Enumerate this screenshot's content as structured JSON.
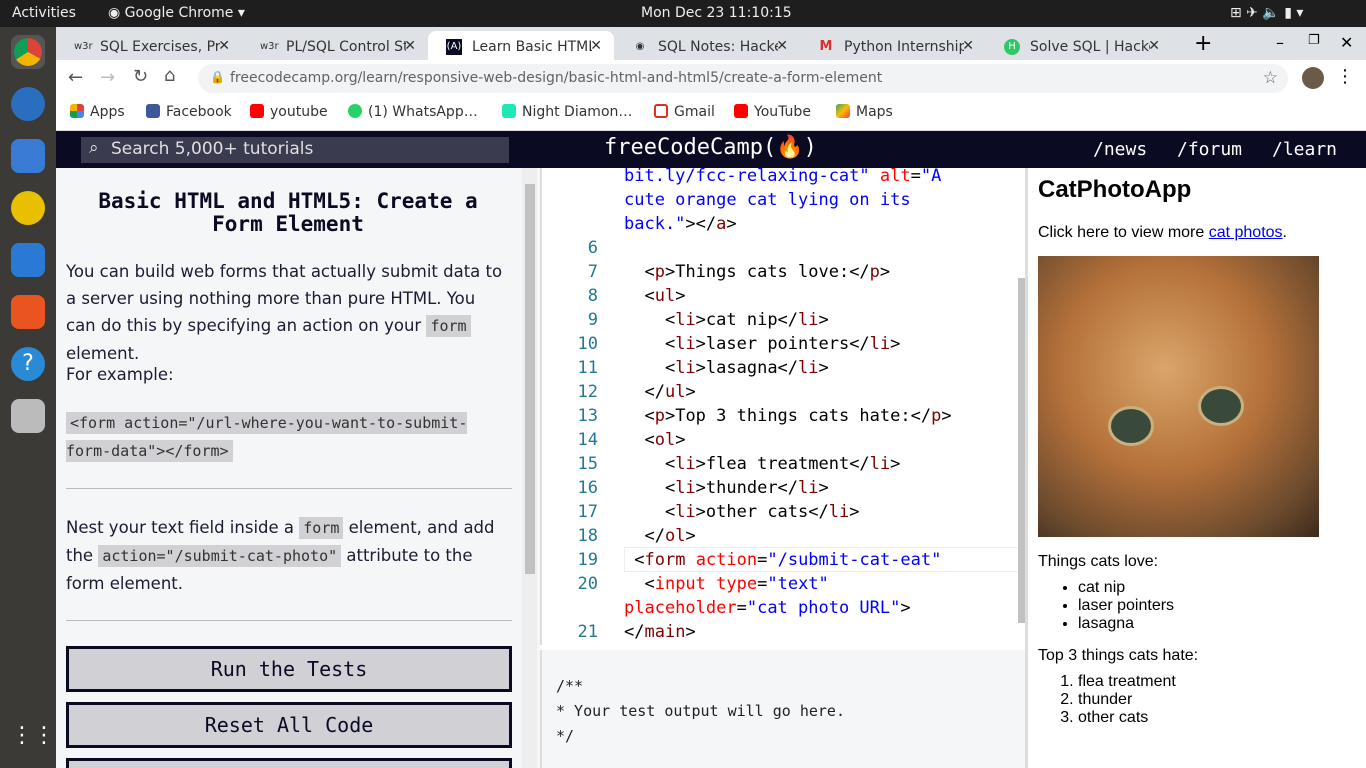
{
  "system": {
    "activities": "Activities",
    "app": "Google Chrome",
    "clock": "Mon Dec 23  11:10:15"
  },
  "tabs": [
    {
      "label": "SQL Exercises, Pra",
      "fav": "w3r"
    },
    {
      "label": "PL/SQL Control St",
      "fav": "w3r"
    },
    {
      "label": "Learn Basic HTML",
      "fav": "(A)",
      "active": true
    },
    {
      "label": "SQL Notes: Hacke",
      "fav": "◉"
    },
    {
      "label": "Python Internship",
      "fav": "M"
    },
    {
      "label": "Solve SQL | Hacker",
      "fav": "H"
    }
  ],
  "address": {
    "url": "freecodecamp.org/learn/responsive-web-design/basic-html-and-html5/create-a-form-element"
  },
  "bookmarks": [
    "Apps",
    "Facebook",
    "youtube",
    "(1) WhatsApp…",
    "Night Diamon…",
    "Gmail",
    "YouTube",
    "Maps"
  ],
  "fcc": {
    "search_placeholder": "Search 5,000+ tutorials",
    "logo": "freeCodeCamp(🔥)",
    "links": [
      "/news",
      "/forum",
      "/learn"
    ]
  },
  "lesson": {
    "title": "Basic HTML and HTML5: Create a Form Element",
    "p1a": "You can build web forms that actually submit data to a server using nothing more than pure HTML. You can do this by specifying an action on your ",
    "p1code": "form",
    "p1b": " element.",
    "p2": "For example:",
    "example": "<form action=\"/url-where-you-want-to-submit-form-data\"></form>",
    "p3a": "Nest your text field inside a ",
    "p3code1": "form",
    "p3b": " element, and add the ",
    "p3code2": "action=\"/submit-cat-photo\"",
    "p3c": " attribute to the form element.",
    "run": "Run the Tests",
    "reset": "Reset All Code"
  },
  "editor": {
    "lines": [
      {
        "n": "",
        "seg": [
          [
            "st",
            "bit.ly/fcc-relaxing-cat\" "
          ],
          [
            "at",
            "alt"
          ],
          [
            "tx",
            "="
          ],
          [
            "st",
            "\"A"
          ]
        ]
      },
      {
        "n": "",
        "seg": [
          [
            "st",
            "cute orange cat lying on its"
          ]
        ]
      },
      {
        "n": "",
        "seg": [
          [
            "st",
            "back.\""
          ],
          [
            "tx",
            "></"
          ],
          [
            "tg",
            "a"
          ],
          [
            "tx",
            ">"
          ]
        ]
      },
      {
        "n": "6",
        "seg": []
      },
      {
        "n": "7",
        "seg": [
          [
            "tx",
            "  <"
          ],
          [
            "tg",
            "p"
          ],
          [
            "tx",
            ">Things cats love:</"
          ],
          [
            "tg",
            "p"
          ],
          [
            "tx",
            ">"
          ]
        ]
      },
      {
        "n": "8",
        "seg": [
          [
            "tx",
            "  <"
          ],
          [
            "tg",
            "ul"
          ],
          [
            "tx",
            ">"
          ]
        ]
      },
      {
        "n": "9",
        "seg": [
          [
            "tx",
            "    <"
          ],
          [
            "tg",
            "li"
          ],
          [
            "tx",
            ">cat nip</"
          ],
          [
            "tg",
            "li"
          ],
          [
            "tx",
            ">"
          ]
        ]
      },
      {
        "n": "10",
        "seg": [
          [
            "tx",
            "    <"
          ],
          [
            "tg",
            "li"
          ],
          [
            "tx",
            ">laser pointers</"
          ],
          [
            "tg",
            "li"
          ],
          [
            "tx",
            ">"
          ]
        ]
      },
      {
        "n": "11",
        "seg": [
          [
            "tx",
            "    <"
          ],
          [
            "tg",
            "li"
          ],
          [
            "tx",
            ">lasagna</"
          ],
          [
            "tg",
            "li"
          ],
          [
            "tx",
            ">"
          ]
        ]
      },
      {
        "n": "12",
        "seg": [
          [
            "tx",
            "  </"
          ],
          [
            "tg",
            "ul"
          ],
          [
            "tx",
            ">"
          ]
        ]
      },
      {
        "n": "13",
        "seg": [
          [
            "tx",
            "  <"
          ],
          [
            "tg",
            "p"
          ],
          [
            "tx",
            ">Top 3 things cats hate:</"
          ],
          [
            "tg",
            "p"
          ],
          [
            "tx",
            ">"
          ]
        ]
      },
      {
        "n": "14",
        "seg": [
          [
            "tx",
            "  <"
          ],
          [
            "tg",
            "ol"
          ],
          [
            "tx",
            ">"
          ]
        ]
      },
      {
        "n": "15",
        "seg": [
          [
            "tx",
            "    <"
          ],
          [
            "tg",
            "li"
          ],
          [
            "tx",
            ">flea treatment</"
          ],
          [
            "tg",
            "li"
          ],
          [
            "tx",
            ">"
          ]
        ]
      },
      {
        "n": "16",
        "seg": [
          [
            "tx",
            "    <"
          ],
          [
            "tg",
            "li"
          ],
          [
            "tx",
            ">thunder</"
          ],
          [
            "tg",
            "li"
          ],
          [
            "tx",
            ">"
          ]
        ]
      },
      {
        "n": "17",
        "seg": [
          [
            "tx",
            "    <"
          ],
          [
            "tg",
            "li"
          ],
          [
            "tx",
            ">other cats</"
          ],
          [
            "tg",
            "li"
          ],
          [
            "tx",
            ">"
          ]
        ]
      },
      {
        "n": "18",
        "seg": [
          [
            "tx",
            "  </"
          ],
          [
            "tg",
            "ol"
          ],
          [
            "tx",
            ">"
          ]
        ]
      },
      {
        "n": "19",
        "seg": [
          [
            "tx",
            " <"
          ],
          [
            "tg",
            "form"
          ],
          [
            "tx",
            " "
          ],
          [
            "at",
            "action"
          ],
          [
            "tx",
            "="
          ],
          [
            "st",
            "\"/submit-cat-eat\""
          ]
        ]
      },
      {
        "n": "20",
        "seg": [
          [
            "tx",
            "  <"
          ],
          [
            "at",
            "input"
          ],
          [
            "tx",
            " "
          ],
          [
            "at",
            "type"
          ],
          [
            "tx",
            "="
          ],
          [
            "st",
            "\"text\""
          ]
        ]
      },
      {
        "n": "",
        "seg": [
          [
            "at",
            "placeholder"
          ],
          [
            "tx",
            "="
          ],
          [
            "st",
            "\"cat photo URL\""
          ],
          [
            "tx",
            ">"
          ]
        ]
      },
      {
        "n": "21",
        "seg": [
          [
            "tx",
            "</"
          ],
          [
            "tg",
            "main"
          ],
          [
            "tx",
            ">"
          ]
        ]
      }
    ]
  },
  "output": "/**\n* Your test output will go here.\n*/",
  "preview": {
    "title": "CatPhotoApp",
    "click_text": "Click here to view more ",
    "link": "cat photos",
    "period": ".",
    "love_title": "Things cats love:",
    "love": [
      "cat nip",
      "laser pointers",
      "lasagna"
    ],
    "hate_title": "Top 3 things cats hate:",
    "hate": [
      "flea treatment",
      "thunder",
      "other cats"
    ]
  }
}
